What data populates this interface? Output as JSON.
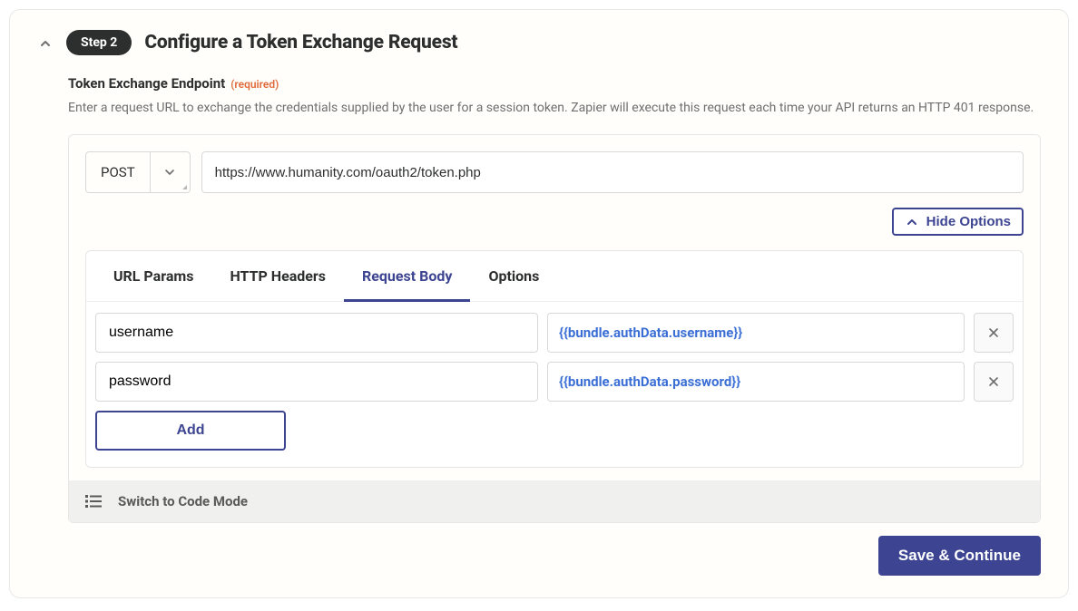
{
  "header": {
    "step_pill": "Step 2",
    "title": "Configure a Token Exchange Request"
  },
  "endpoint": {
    "label": "Token Exchange Endpoint",
    "required_tag": "(required)",
    "help_text": "Enter a request URL to exchange the credentials supplied by the user for a session token. Zapier will execute this request each time your API returns an HTTP 401 response.",
    "method": "POST",
    "url": "https://www.humanity.com/oauth2/token.php"
  },
  "options_toggle": {
    "label": "Hide Options"
  },
  "tabs": {
    "url_params": "URL Params",
    "http_headers": "HTTP Headers",
    "request_body": "Request Body",
    "options": "Options",
    "active": "request_body"
  },
  "request_body_rows": [
    {
      "key": "username",
      "value": "{{bundle.authData.username}}"
    },
    {
      "key": "password",
      "value": "{{bundle.authData.password}}"
    }
  ],
  "add_button_label": "Add",
  "code_mode_label": "Switch to Code Mode",
  "save_button_label": "Save & Continue"
}
